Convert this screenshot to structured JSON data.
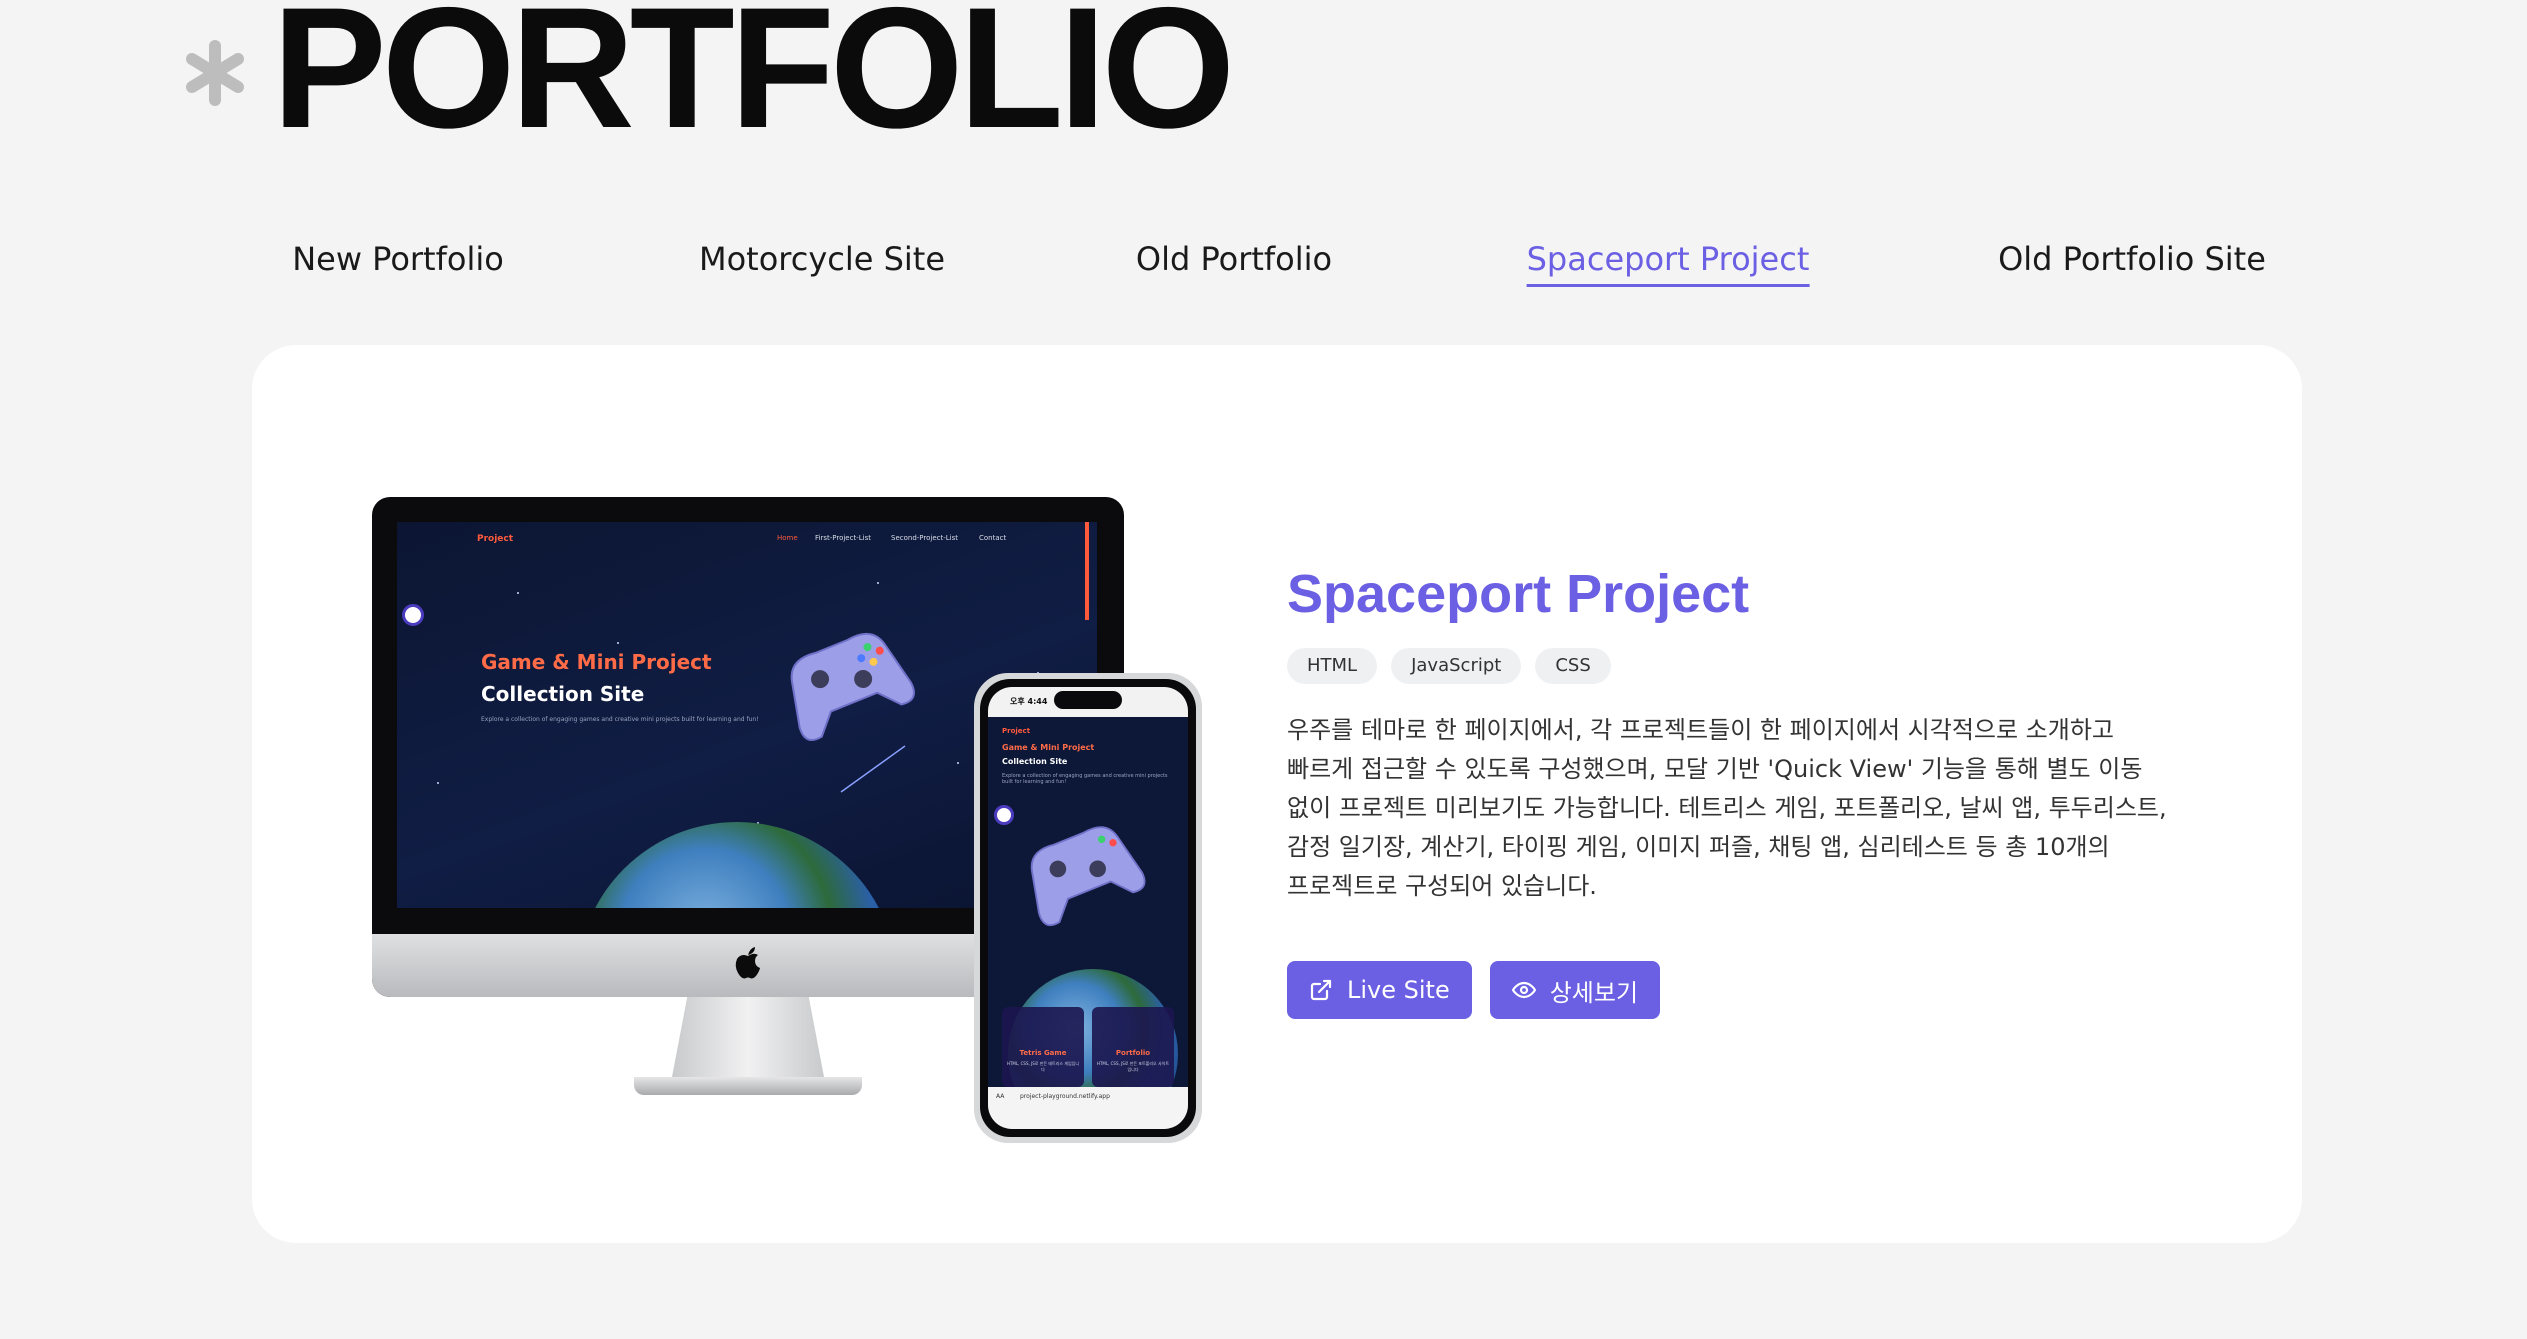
{
  "header": {
    "title": "PORTFOLIO",
    "decor_icon": "asterisk-icon"
  },
  "tabs": [
    {
      "label": "New Portfolio",
      "active": false
    },
    {
      "label": "Motorcycle Site",
      "active": false
    },
    {
      "label": "Old Portfolio",
      "active": false
    },
    {
      "label": "Spaceport Project",
      "active": true
    },
    {
      "label": "Old Portfolio Site",
      "active": false
    }
  ],
  "project": {
    "title": "Spaceport Project",
    "tags": [
      "HTML",
      "JavaScript",
      "CSS"
    ],
    "description": "우주를 테마로 한 페이지에서, 각 프로젝트들이 한 페이지에서 시각적으로 소개하고 빠르게 접근할 수 있도록 구성했으며, 모달 기반 'Quick View' 기능을 통해 별도 이동 없이 프로젝트 미리보기도 가능합니다. 테트리스 게임, 포트폴리오, 날씨 앱, 투두리스트, 감정 일기장, 계산기, 타이핑 게임, 이미지 퍼즐, 채팅 앱, 심리테스트 등 총 10개의 프로젝트로 구성되어 있습니다.",
    "buttons": {
      "live_site": "Live Site",
      "details": "상세보기"
    },
    "icons": {
      "live_site": "external-link-icon",
      "details": "eye-icon"
    }
  },
  "mockup": {
    "desktop": {
      "logo": "Project",
      "nav": [
        "Home",
        "First-Project-List",
        "Second-Project-List",
        "Contact"
      ],
      "heading_line1": "Game & Mini Project",
      "heading_line2": "Collection Site",
      "subtitle": "Explore a collection of engaging games and creative mini projects built for learning and fun!"
    },
    "mobile": {
      "time": "오후 4:44",
      "logo": "Project",
      "heading_line1": "Game & Mini Project",
      "heading_line2": "Collection Site",
      "subtitle": "Explore a collection of engaging games and creative mini projects built for learning and fun!",
      "cards": [
        {
          "title": "Tetris Game",
          "desc": "HTML, CSS, JS로 만든 테트리스 게임입니다"
        },
        {
          "title": "Portfolio",
          "desc": "HTML, CSS, JS로 만든 포트폴리오 사이트입니다"
        }
      ],
      "url": "project-playground.netlify.app",
      "aa": "AA"
    }
  },
  "colors": {
    "accent": "#6b5fe3",
    "background": "#f4f4f4",
    "card": "#ffffff",
    "screen_accent": "#ff5a3c"
  }
}
